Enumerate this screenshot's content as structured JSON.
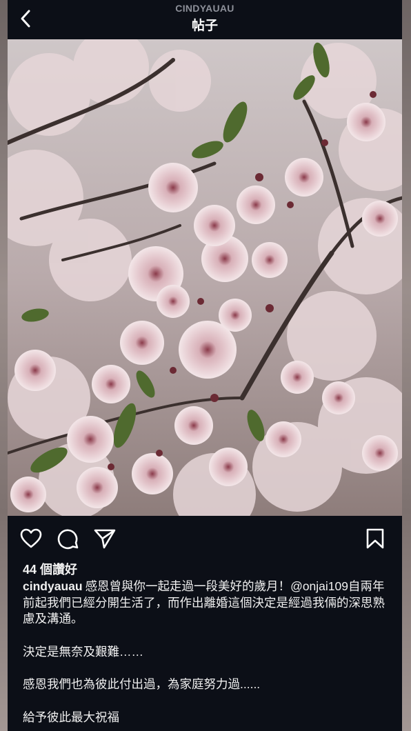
{
  "header": {
    "username": "CINDYAUAU",
    "title": "帖子",
    "back_icon": "chevron-left-icon"
  },
  "post": {
    "image_subject": "cherry blossom photo",
    "likes_label": "44 個讚好",
    "author": "cindyauau",
    "caption_lines": [
      "感恩曾與你一起走過一段美好的歲月！",
      "自兩年前起我們已經分開生活了，而作出離婚這個決定是經過我倆的深思熟慮及溝通。",
      "決定是無奈及艱難……",
      "感恩我們也為彼此付出過，為家庭努力過......",
      "給予彼此最大祝福"
    ],
    "mention": "@onjai109"
  },
  "actions": {
    "like_icon": "heart-icon",
    "comment_icon": "comment-icon",
    "share_icon": "send-icon",
    "save_icon": "bookmark-icon"
  },
  "colors": {
    "background": "#0c0f17",
    "text": "#f0f0f0",
    "muted": "#8d9099"
  }
}
